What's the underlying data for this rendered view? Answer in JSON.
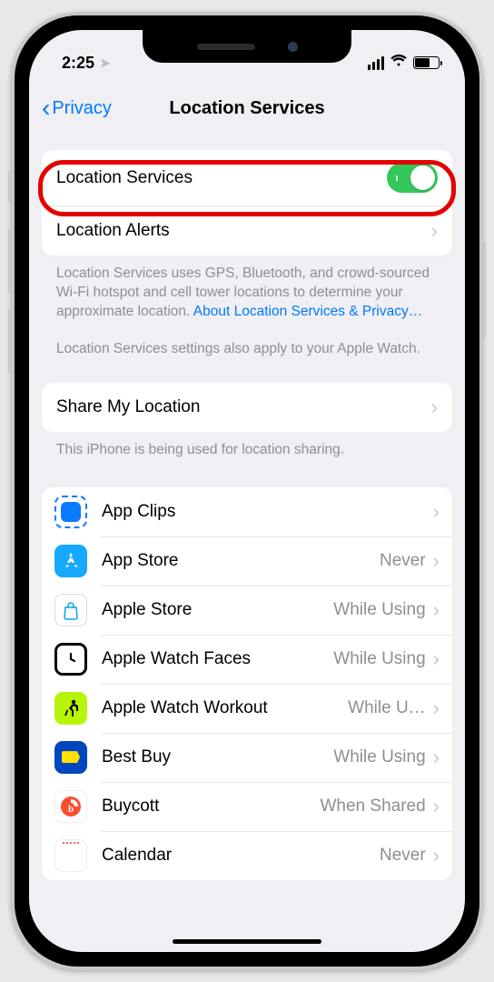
{
  "status": {
    "time": "2:25",
    "location_arrow": true
  },
  "nav": {
    "back_label": "Privacy",
    "title": "Location Services"
  },
  "toggle_row": {
    "label": "Location Services",
    "enabled": true,
    "highlighted": true
  },
  "alerts_row": {
    "label": "Location Alerts"
  },
  "desc": {
    "text1": "Location Services uses GPS, Bluetooth, and crowd-sourced Wi-Fi hotspot and cell tower locations to determine your approximate location. ",
    "link": "About Location Services & Privacy…",
    "text2": "Location Services settings also apply to your Apple Watch."
  },
  "share_row": {
    "label": "Share My Location"
  },
  "share_footer": "This iPhone is being used for location sharing.",
  "apps": [
    {
      "name": "App Clips",
      "value": "",
      "icon": "appclips"
    },
    {
      "name": "App Store",
      "value": "Never",
      "icon": "appstore"
    },
    {
      "name": "Apple Store",
      "value": "While Using",
      "icon": "applestore"
    },
    {
      "name": "Apple Watch Faces",
      "value": "While Using",
      "icon": "watchfaces"
    },
    {
      "name": "Apple Watch Workout",
      "value": "While U…",
      "icon": "watchworkout"
    },
    {
      "name": "Best Buy",
      "value": "While Using",
      "icon": "bestbuy"
    },
    {
      "name": "Buycott",
      "value": "When Shared",
      "icon": "buycott"
    },
    {
      "name": "Calendar",
      "value": "Never",
      "icon": "calendar"
    }
  ],
  "colors": {
    "link": "#007aff",
    "toggle_on": "#34c759",
    "highlight": "#e40000"
  }
}
